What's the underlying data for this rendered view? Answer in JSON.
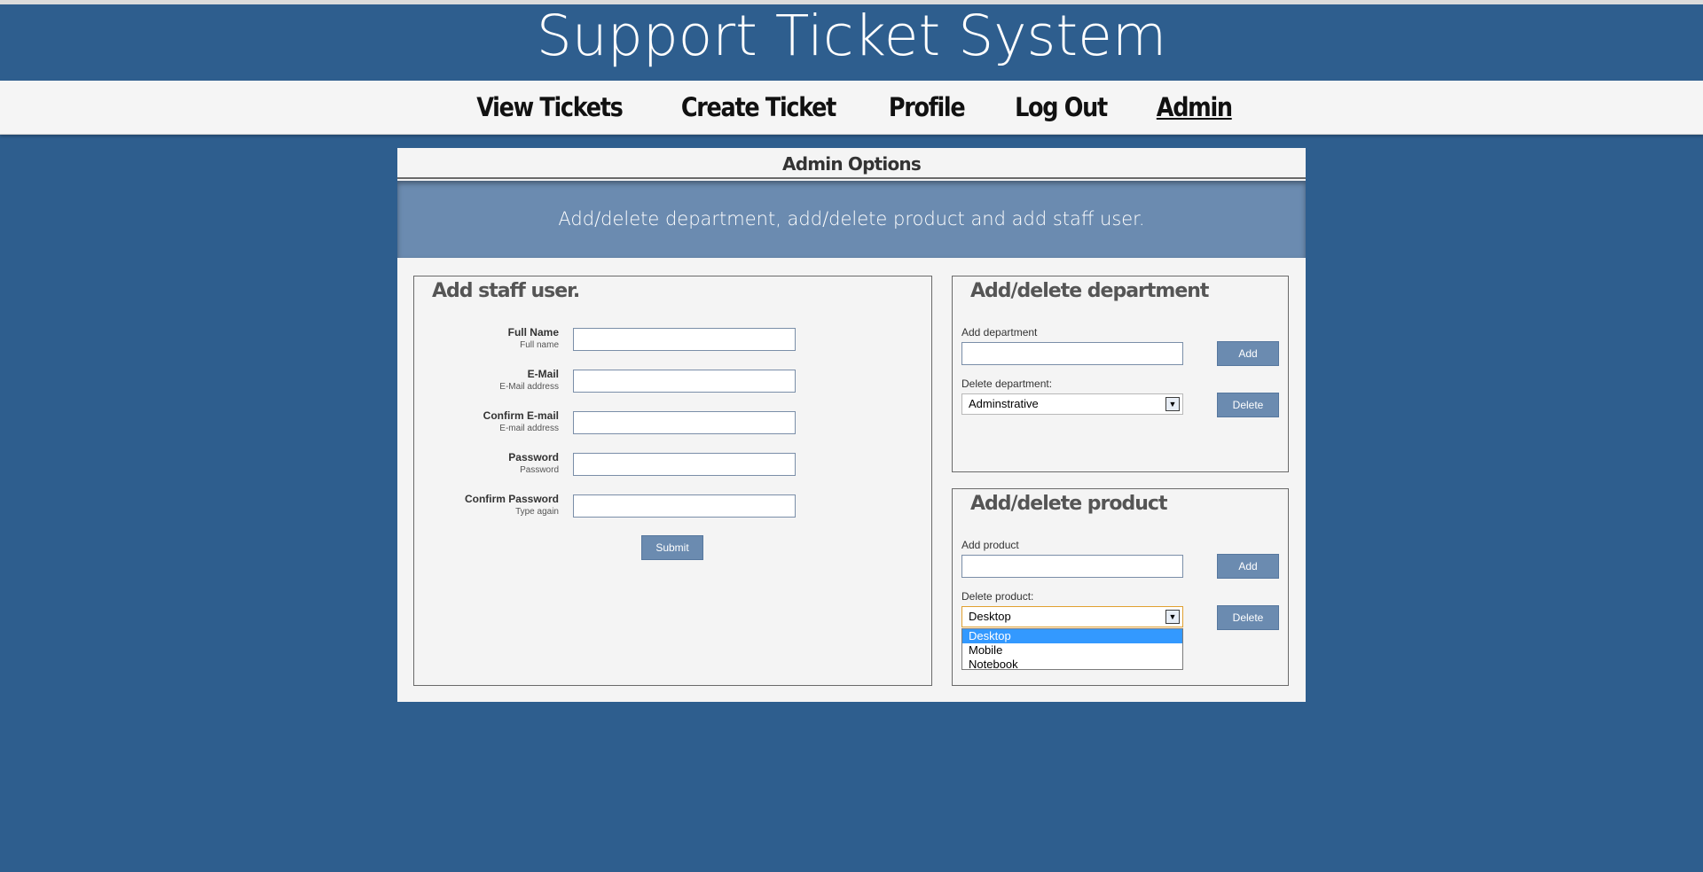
{
  "header": {
    "title": "Support Ticket System"
  },
  "nav": {
    "items": [
      {
        "label": "View Tickets"
      },
      {
        "label": "Create Ticket"
      },
      {
        "label": "Profile"
      },
      {
        "label": "Log Out"
      },
      {
        "label": "Admin"
      }
    ],
    "active": "Admin"
  },
  "main": {
    "title": "Admin Options",
    "banner": "Add/delete department, add/delete product and add staff user."
  },
  "staff": {
    "heading": "Add staff user.",
    "fields": [
      {
        "label": "Full Name",
        "hint": "Full name",
        "value": ""
      },
      {
        "label": "E-Mail",
        "hint": "E-Mail address",
        "value": ""
      },
      {
        "label": "Confirm E-mail",
        "hint": "E-mail address",
        "value": ""
      },
      {
        "label": "Password",
        "hint": "Password",
        "value": ""
      },
      {
        "label": "Confirm Password",
        "hint": "Type again",
        "value": ""
      }
    ],
    "submit_label": "Submit"
  },
  "department": {
    "heading": "Add/delete department",
    "add_label": "Add department",
    "add_value": "",
    "add_button": "Add",
    "delete_label": "Delete department:",
    "selected": "Adminstrative",
    "delete_button": "Delete"
  },
  "product": {
    "heading": "Add/delete product",
    "add_label": "Add product",
    "add_value": "",
    "add_button": "Add",
    "delete_label": "Delete product:",
    "selected": "Desktop",
    "delete_button": "Delete",
    "options": [
      "Desktop",
      "Mobile",
      "Notebook"
    ]
  },
  "colors": {
    "background": "#2e5e8e",
    "banner": "#6b8bb0",
    "button": "#6b8bb0",
    "dropdown_highlight": "#3399ff"
  },
  "icons": {
    "select_arrow": "chevron-down-icon"
  }
}
